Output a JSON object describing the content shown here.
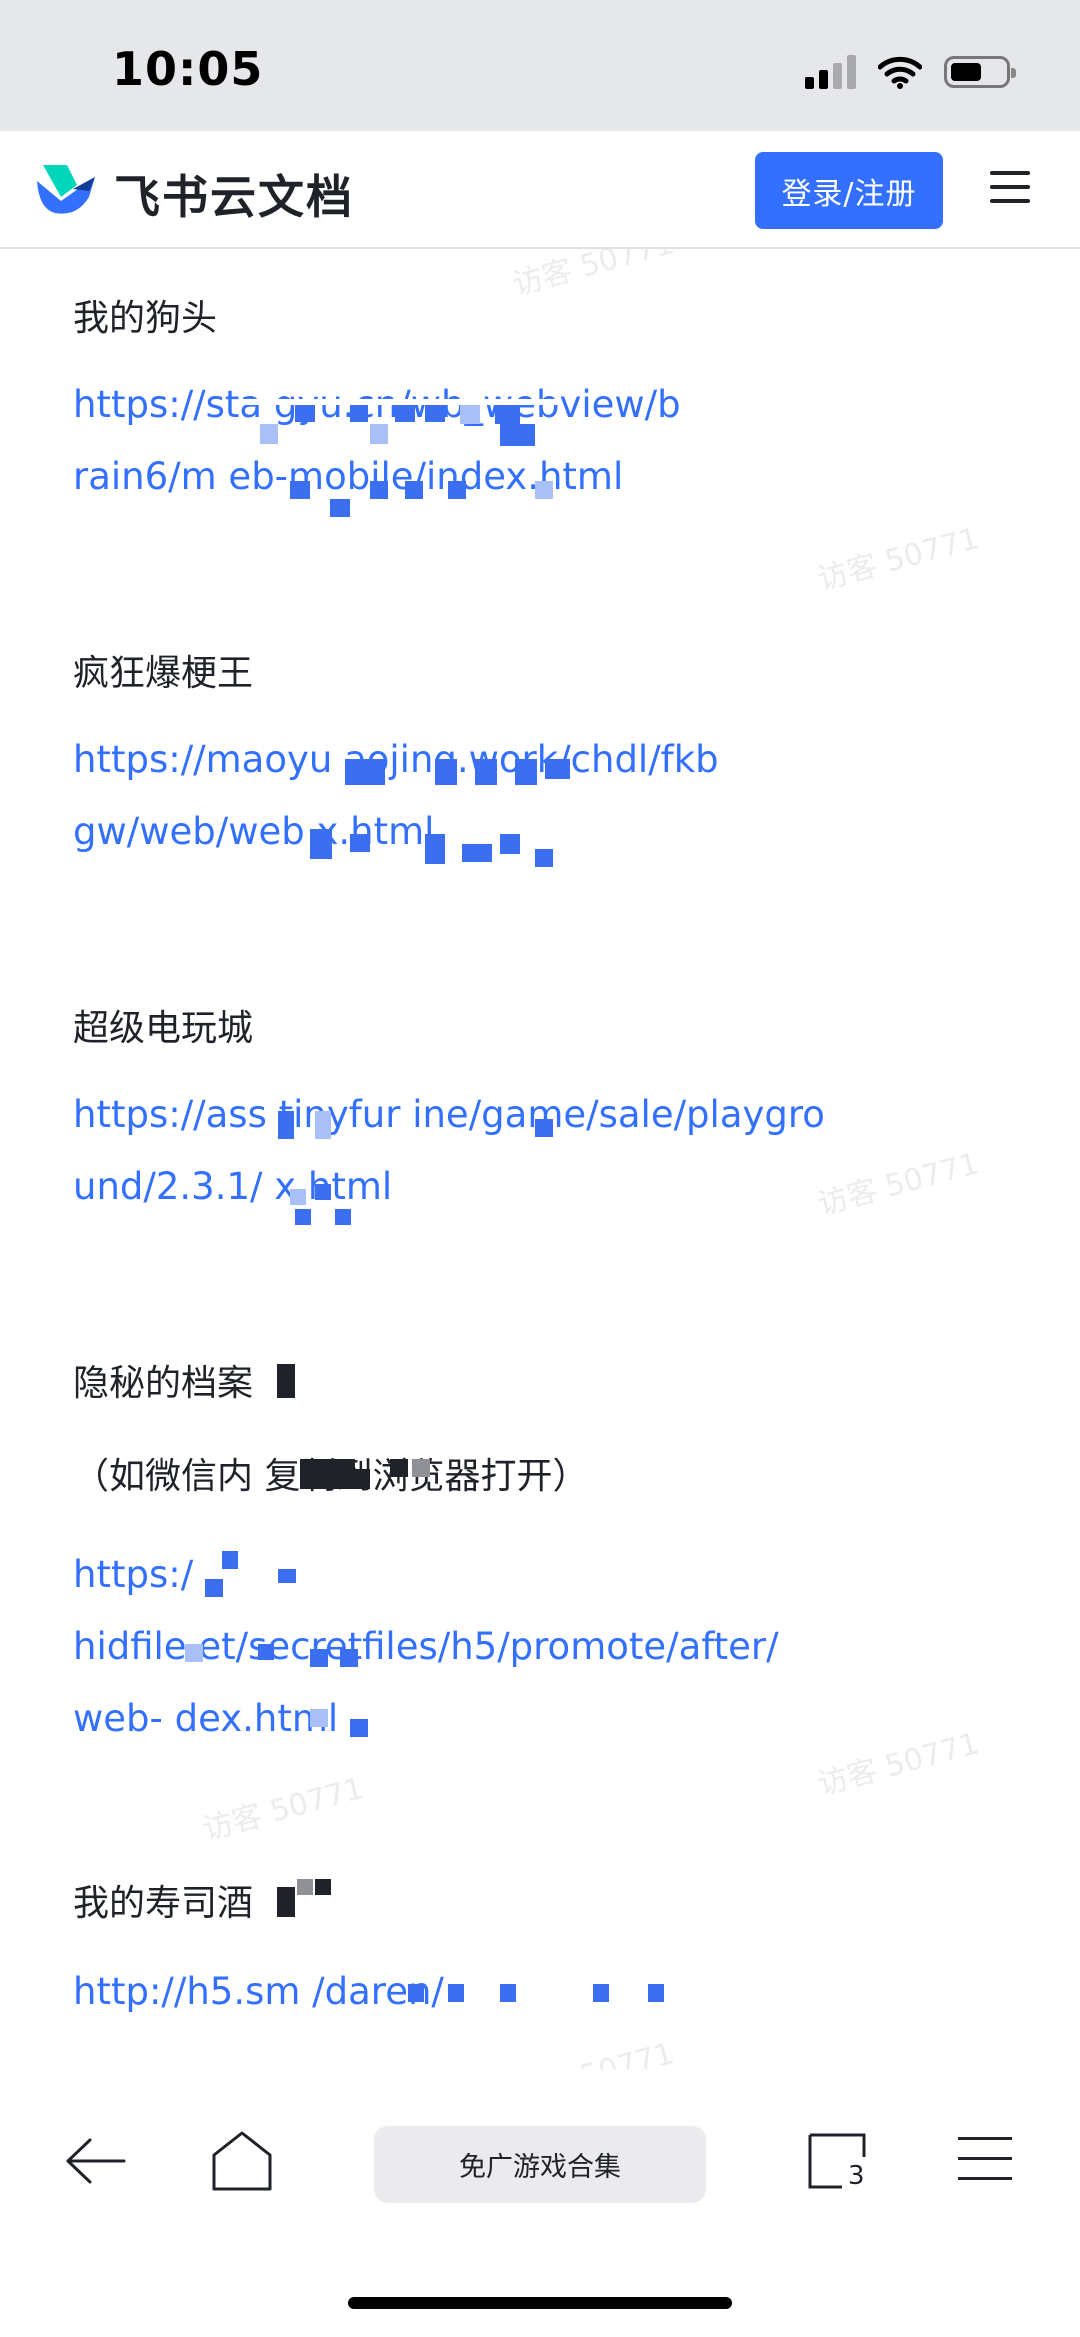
{
  "status_bar": {
    "time": "10:05"
  },
  "header": {
    "brand_name": "飞书云文档",
    "login_label": "登录/注册",
    "accent_color": "#3370ff"
  },
  "watermark": {
    "text": "访客 50771"
  },
  "entries": [
    {
      "title": "我的狗头",
      "link_lines": [
        "https://sta          gyu.cn/wb_webview/b",
        "rain6/m                   eb-mobile/index.html"
      ]
    },
    {
      "title": "疯狂爆梗王",
      "link_lines": [
        "https://maoyu              aojing.work/chdl/fkb",
        "gw/web/web                 x.html"
      ]
    },
    {
      "title": "超级电玩城",
      "link_lines": [
        "https://ass        tinyfur      ine/game/sale/playgro",
        "und/2.3.1/       x.html"
      ]
    },
    {
      "title": "隐秘的档案",
      "note": "（如微信内               复制到浏览器打开）",
      "link_lines": [
        "https:/",
        "hidfile              et/secretfiles/h5/promote/after/",
        "web-        dex.html"
      ]
    },
    {
      "title": "我的寿司酒",
      "link_lines": [
        "http://h5.sm                          /daren/"
      ]
    }
  ],
  "bottom_bar": {
    "center_label": "免广游戏合集",
    "tab_count": "3",
    "icons": [
      "back-arrow-icon",
      "home-icon",
      "tabs-icon",
      "menu-icon"
    ]
  }
}
